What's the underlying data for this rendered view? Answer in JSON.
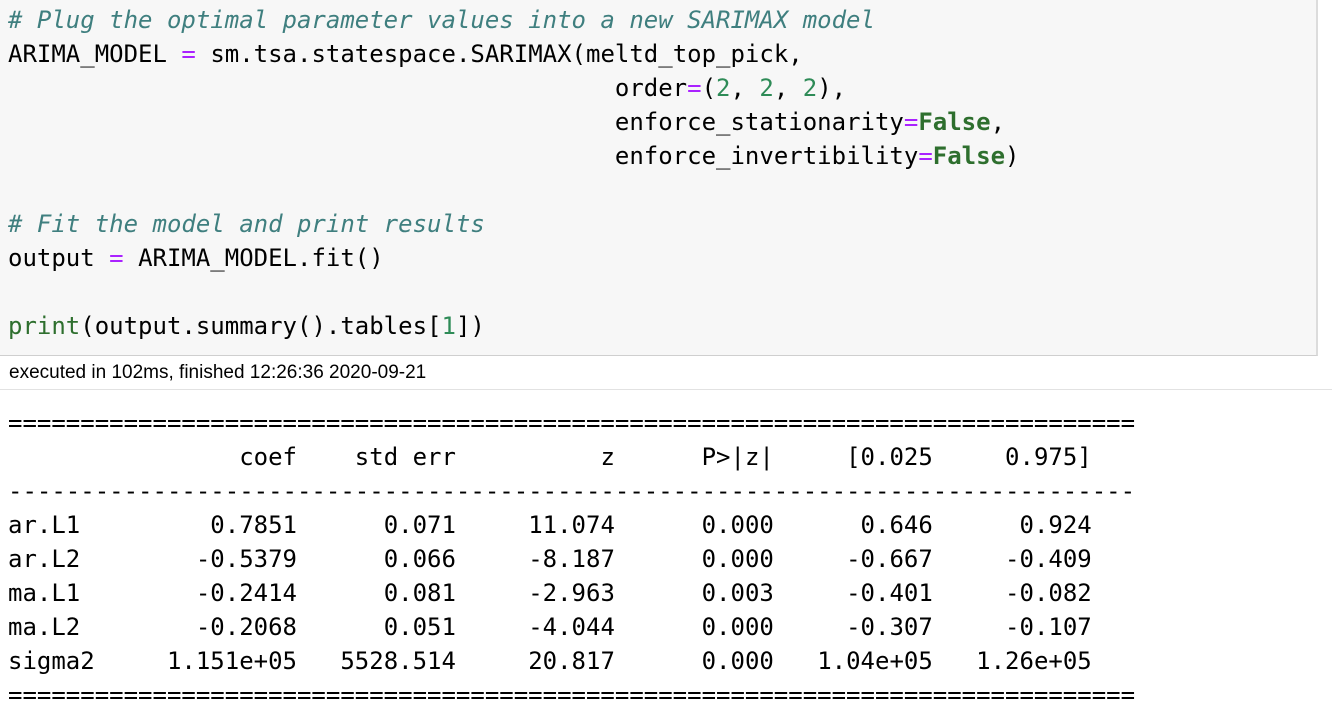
{
  "code": {
    "comment_plug": "# Plug the optimal parameter values into a new SARIMAX model",
    "model_var": "ARIMA_MODEL",
    "assign_op": "=",
    "model_call": "sm.tsa.statespace.SARIMAX(meltd_top_pick,",
    "order_kw": "order",
    "order_open": "(",
    "order_vals": [
      "2",
      "2",
      "2"
    ],
    "order_close": "),",
    "stationarity_kw": "enforce_stationarity",
    "invertibility_kw": "enforce_invertibility",
    "false_literal": "False",
    "comment_fit": "# Fit the model and print results",
    "output_var": "output",
    "fit_call": "ARIMA_MODEL.fit()",
    "print_fn": "print",
    "summary_call": "(output.summary().tables[",
    "tables_index": "1",
    "summary_close": "])"
  },
  "execution": {
    "info": "executed in 102ms, finished 12:26:36 2020-09-21"
  },
  "summary_table": {
    "double_rule": "==============================================================================",
    "single_rule": "------------------------------------------------------------------------------",
    "columns": [
      "",
      "coef",
      "std err",
      "z",
      "P>|z|",
      "[0.025",
      "0.975]"
    ],
    "rows": [
      [
        "ar.L1",
        "0.7851",
        "0.071",
        "11.074",
        "0.000",
        "0.646",
        "0.924"
      ],
      [
        "ar.L2",
        "-0.5379",
        "0.066",
        "-8.187",
        "0.000",
        "-0.667",
        "-0.409"
      ],
      [
        "ma.L1",
        "-0.2414",
        "0.081",
        "-2.963",
        "0.003",
        "-0.401",
        "-0.082"
      ],
      [
        "ma.L2",
        "-0.2068",
        "0.051",
        "-4.044",
        "0.000",
        "-0.307",
        "-0.107"
      ],
      [
        "sigma2",
        "1.151e+05",
        "5528.514",
        "20.817",
        "0.000",
        "1.04e+05",
        "1.26e+05"
      ]
    ]
  }
}
